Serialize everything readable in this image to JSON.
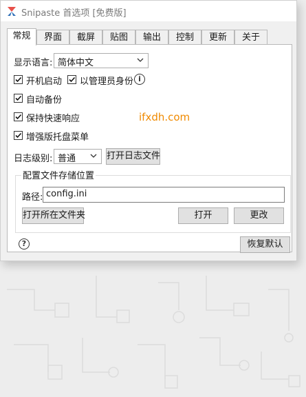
{
  "window": {
    "title": "Snipaste 首选项 [免费版]"
  },
  "tabs": [
    {
      "label": "常规",
      "active": true
    },
    {
      "label": "界面"
    },
    {
      "label": "截屏"
    },
    {
      "label": "贴图"
    },
    {
      "label": "输出"
    },
    {
      "label": "控制"
    },
    {
      "label": "更新"
    },
    {
      "label": "关于"
    }
  ],
  "general": {
    "language_label": "显示语言:",
    "language_value": "简体中文",
    "startup_label": "开机启动",
    "startup_checked": true,
    "admin_label": "以管理员身份",
    "admin_checked": true,
    "info_icon": "i",
    "backup_label": "自动备份",
    "backup_checked": true,
    "hotkey_label": "保持快速响应",
    "hotkey_checked": true,
    "tray_label": "增强版托盘菜单",
    "tray_checked": true,
    "log_level_label": "日志级别:",
    "log_level_value": "普通",
    "open_log_button": "打开日志文件",
    "watermark": "ifxdh.com"
  },
  "config": {
    "group_title": "配置文件存储位置",
    "path_label": "路径:",
    "path_value": "config.ini",
    "open_folder_button": "打开所在文件夹",
    "open_button": "打开",
    "change_button": "更改"
  },
  "footer": {
    "help_icon": "?",
    "restore_button": "恢复默认"
  },
  "colors": {
    "watermark": "#f08a00",
    "panel_bg": "#ffffff",
    "window_bg": "#f0f0f0"
  }
}
